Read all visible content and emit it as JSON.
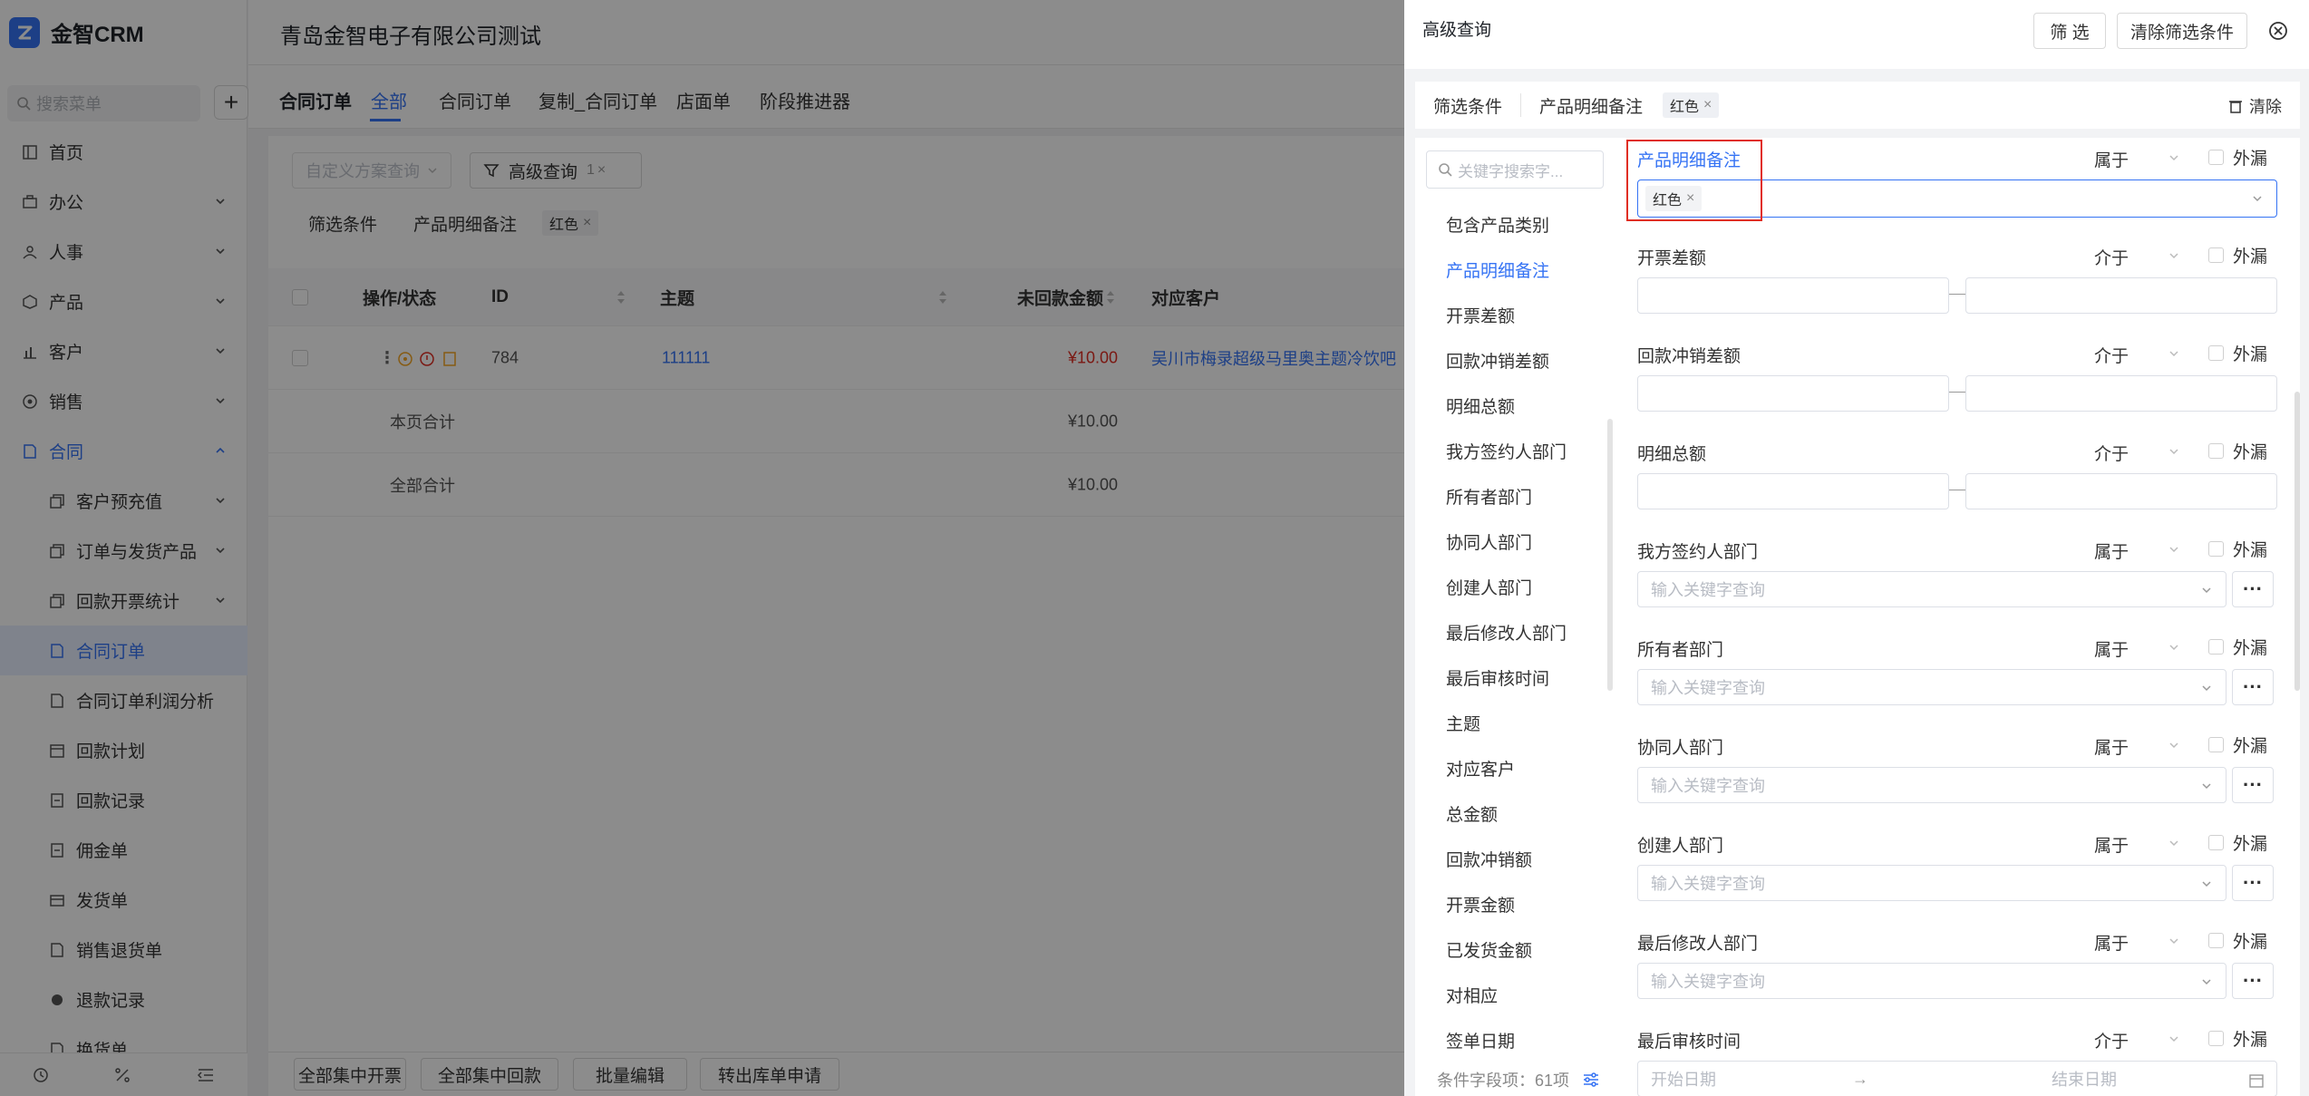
{
  "app": {
    "brand": "金智CRM",
    "company": "青岛金智电子有限公司测试",
    "colors": {
      "accent": "#3573f4",
      "danger": "#e02e24",
      "highlight_box": "#e02e24"
    }
  },
  "sidebar": {
    "search_placeholder": "搜索菜单",
    "items": [
      {
        "label": "首页",
        "icon": "home-icon"
      },
      {
        "label": "办公",
        "icon": "briefcase-icon"
      },
      {
        "label": "人事",
        "icon": "people-icon"
      },
      {
        "label": "产品",
        "icon": "cube-icon"
      },
      {
        "label": "客户",
        "icon": "bar-chart-icon"
      },
      {
        "label": "销售",
        "icon": "target-icon"
      },
      {
        "label": "合同",
        "icon": "document-icon"
      },
      {
        "label": "客户预充值",
        "icon": "copy-icon"
      },
      {
        "label": "订单与发货产品",
        "icon": "copy-icon"
      },
      {
        "label": "回款开票统计",
        "icon": "copy-icon"
      },
      {
        "label": "合同订单",
        "icon": "document-icon"
      },
      {
        "label": "合同订单利润分析",
        "icon": "document-icon"
      },
      {
        "label": "回款计划",
        "icon": "calendar-icon"
      },
      {
        "label": "回款记录",
        "icon": "receipt-icon"
      },
      {
        "label": "佣金单",
        "icon": "receipt-icon"
      },
      {
        "label": "发货单",
        "icon": "box-icon"
      },
      {
        "label": "销售退货单",
        "icon": "document-icon"
      },
      {
        "label": "退款记录",
        "icon": "refund-icon"
      },
      {
        "label": "换货单",
        "icon": "document-icon"
      }
    ]
  },
  "tabs": {
    "title": "合同订单",
    "items": [
      "全部",
      "合同订单",
      "复制_合同订单",
      "店面单",
      "阶段推进器"
    ]
  },
  "toolbar": {
    "scheme_placeholder": "自定义方案查询",
    "adv_query_label": "高级查询",
    "adv_query_count": "1",
    "cond_label": "筛选条件",
    "cond_field": "产品明细备注",
    "cond_tag": "红色"
  },
  "table": {
    "headers": [
      "操作/状态",
      "ID",
      "主题",
      "未回款金额",
      "对应客户"
    ],
    "rows": [
      {
        "id": "784",
        "subject": "111111",
        "unpaid": "¥10.00",
        "customer": "吴川市梅录超级马里奥主题冷饮吧"
      }
    ],
    "page_total_label": "本页合计",
    "page_total_value": "¥10.00",
    "all_total_label": "全部合计",
    "all_total_value": "¥10.00"
  },
  "bottom_actions": [
    "全部集中开票",
    "全部集中回款",
    "批量编辑",
    "转出库单申请"
  ],
  "drawer": {
    "title": "高级查询",
    "filter_button": "筛 选",
    "clear_filter_button": "清除筛选条件",
    "cond_label": "筛选条件",
    "cond_field": "产品明细备注",
    "cond_tag": "红色",
    "clear_label": "清除",
    "field_search_placeholder": "关键字搜索字...",
    "fields": [
      "包含产品类别",
      "产品明细备注",
      "开票差额",
      "回款冲销差额",
      "明细总额",
      "我方签约人部门",
      "所有者部门",
      "协同人部门",
      "创建人部门",
      "最后修改人部门",
      "最后审核时间",
      "主题",
      "对应客户",
      "总金额",
      "回款冲销额",
      "开票金额",
      "已发货金额",
      "对相应",
      "签单日期"
    ],
    "field_count_label": "条件字段项：61项",
    "conditions": [
      {
        "label": "产品明细备注",
        "op": "属于",
        "ext": "外漏",
        "tag": "红色"
      },
      {
        "label": "开票差额",
        "op": "介于",
        "ext": "外漏"
      },
      {
        "label": "回款冲销差额",
        "op": "介于",
        "ext": "外漏"
      },
      {
        "label": "明细总额",
        "op": "介于",
        "ext": "外漏"
      },
      {
        "label": "我方签约人部门",
        "op": "属于",
        "ext": "外漏",
        "placeholder": "输入关键字查询"
      },
      {
        "label": "所有者部门",
        "op": "属于",
        "ext": "外漏",
        "placeholder": "输入关键字查询"
      },
      {
        "label": "协同人部门",
        "op": "属于",
        "ext": "外漏",
        "placeholder": "输入关键字查询"
      },
      {
        "label": "创建人部门",
        "op": "属于",
        "ext": "外漏",
        "placeholder": "输入关键字查询"
      },
      {
        "label": "最后修改人部门",
        "op": "属于",
        "ext": "外漏",
        "placeholder": "输入关键字查询"
      },
      {
        "label": "最后审核时间",
        "op": "介于",
        "ext": "外漏",
        "start_placeholder": "开始日期",
        "end_placeholder": "结束日期",
        "arrow": "→"
      }
    ]
  }
}
